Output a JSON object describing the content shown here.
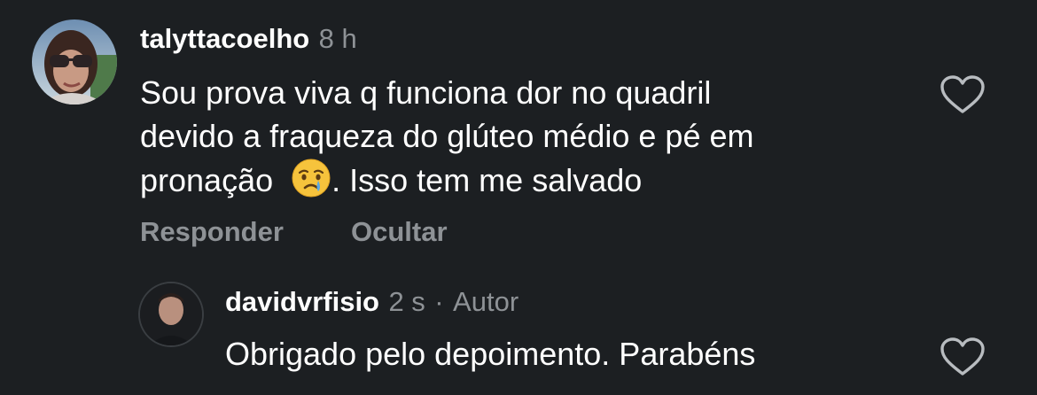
{
  "comment": {
    "username": "talyttacoelho",
    "time": "8 h",
    "lines": [
      "Sou prova viva q funciona dor no quadril",
      "devido a fraqueza do glúteo médio e pé em",
      "pronação",
      ". Isso tem me salvado"
    ],
    "emoji": "crying-face-emoji",
    "reply_label": "Responder",
    "hide_label": "Ocultar"
  },
  "reply": {
    "username": "davidvrfisio",
    "time": "2 s",
    "separator": "·",
    "author_badge": "Autor",
    "text": "Obrigado pelo depoimento. Parabéns"
  },
  "icons": {
    "like": "heart-outline-icon",
    "avatar": "avatar"
  },
  "colors": {
    "background": "#1c1f22",
    "muted": "#8e9296",
    "text": "#ffffff"
  }
}
